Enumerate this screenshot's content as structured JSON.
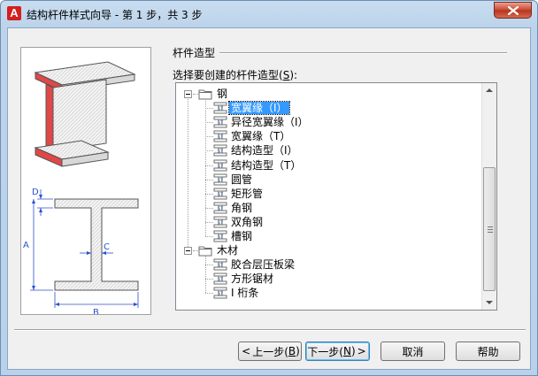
{
  "window": {
    "title": "结构杆件样式向导 - 第 1 步，共 3 步",
    "app_icon_letter": "A"
  },
  "preview": {
    "dimension_labels": {
      "d": "D",
      "a": "A",
      "c": "C",
      "b": "B"
    }
  },
  "group": {
    "title": "杆件造型"
  },
  "tree": {
    "label_prefix": "选择要创建的杆件造型(",
    "label_mnemonic": "S",
    "label_suffix": "):",
    "folders": [
      {
        "name": "钢",
        "items": [
          "宽翼缘（I）",
          "异径宽翼缘（I）",
          "宽翼缘（T）",
          "结构造型（I）",
          "结构造型（T）",
          "圆管",
          "矩形管",
          "角钢",
          "双角钢",
          "槽钢"
        ]
      },
      {
        "name": "木材",
        "items": [
          "胶合层压板梁",
          "方形锯材",
          "I 桁条"
        ]
      }
    ],
    "selected": "宽翼缘（I）"
  },
  "buttons": {
    "back": {
      "label": "上一步(",
      "mnemonic": "B",
      "suffix": ")"
    },
    "next": {
      "label": "下一步(",
      "mnemonic": "N",
      "suffix": ")"
    },
    "cancel": {
      "label": "取消"
    },
    "help": {
      "label": "帮助"
    }
  },
  "colors": {
    "selection": "#3399ff",
    "flange_red": "#e04848",
    "dimension_blue": "#2b4fd1"
  }
}
